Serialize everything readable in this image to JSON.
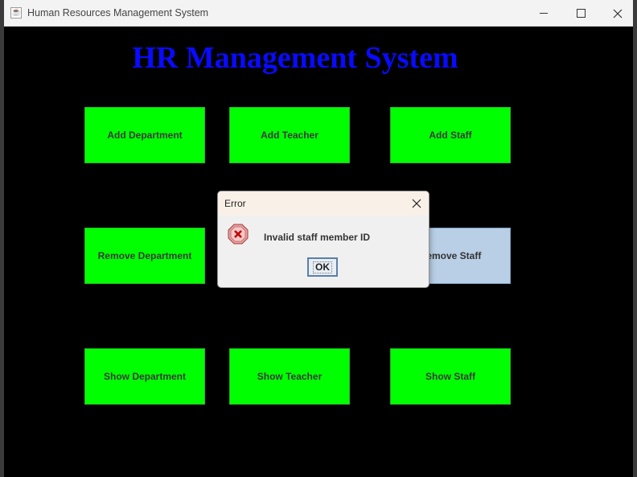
{
  "window": {
    "title": "Human Resources Management System",
    "app_icon": "java-cup-icon"
  },
  "header": {
    "title": "HR Management System",
    "color": "#0a0aff"
  },
  "buttons": {
    "add_department": "Add Department",
    "add_teacher": "Add Teacher",
    "add_staff": "Add Staff",
    "remove_department": "Remove Department",
    "remove_staff": "Remove Staff",
    "show_department": "Show Department",
    "show_teacher": "Show Teacher",
    "show_staff": "Show Staff",
    "accent": "#00ff00"
  },
  "dialog": {
    "title": "Error",
    "message": "Invalid staff member ID",
    "ok_label": "OK",
    "icon": "error-icon"
  }
}
